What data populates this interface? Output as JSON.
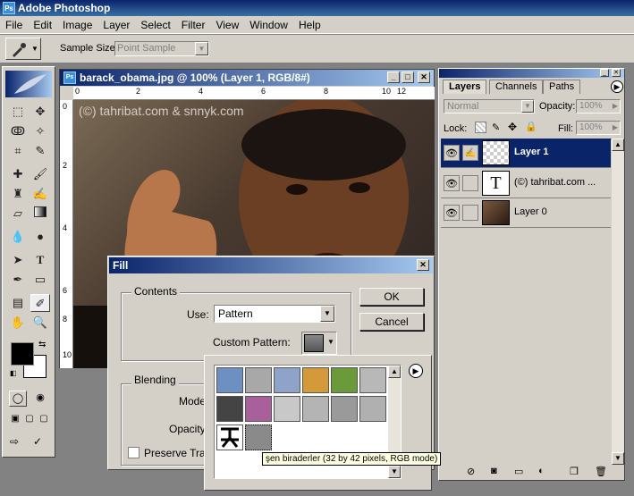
{
  "app": {
    "title": "Adobe Photoshop"
  },
  "menu": [
    "File",
    "Edit",
    "Image",
    "Layer",
    "Select",
    "Filter",
    "View",
    "Window",
    "Help"
  ],
  "options": {
    "sample_size_label": "Sample Size:",
    "sample_size_value": "Point Sample"
  },
  "document": {
    "title": "barack_obama.jpg @ 100% (Layer 1, RGB/8#)",
    "watermark": "(©) tahribat.com & snnyk.com",
    "ruler_h": [
      "0",
      "2",
      "4",
      "6",
      "8",
      "10",
      "12"
    ],
    "ruler_v": [
      "0",
      "2",
      "4",
      "6",
      "8",
      "10"
    ]
  },
  "layers_panel": {
    "tabs": [
      "Layers",
      "Channels",
      "Paths"
    ],
    "blend_mode": "Normal",
    "opacity_label": "Opacity:",
    "opacity_value": "100%",
    "lock_label": "Lock:",
    "fill_label": "Fill:",
    "fill_value": "100%",
    "layers": [
      {
        "name": "Layer 1",
        "selected": true
      },
      {
        "name": "(©) tahribat.com ...",
        "selected": false
      },
      {
        "name": "Layer 0",
        "selected": false
      }
    ]
  },
  "fill_dialog": {
    "title": "Fill",
    "contents_label": "Contents",
    "use_label": "Use:",
    "use_value": "Pattern",
    "custom_pattern_label": "Custom Pattern:",
    "blending_label": "Blending",
    "mode_label": "Mode",
    "opacity_label": "Opacity",
    "preserve_label": "Preserve Tra",
    "ok_label": "OK",
    "cancel_label": "Cancel"
  },
  "pattern_picker": {
    "tooltip": "şen biraderler (32 by 42 pixels, RGB mode)",
    "swatch_colors": [
      "#6d8fc2",
      "#a8a8a8",
      "#8fa2c8",
      "#d49a3a",
      "#6a9a3a",
      "#b8b8b8",
      "#444444",
      "#a85f9a",
      "#c8c8c8",
      "#b4b4b4",
      "#9a9a9a",
      "#b0b0b0",
      "#111111",
      "#8a8a8a"
    ]
  },
  "colors": {
    "titlebar": "#0a246a",
    "selected_layer": "#0a246a",
    "panel_bg": "#d4d0c8"
  }
}
